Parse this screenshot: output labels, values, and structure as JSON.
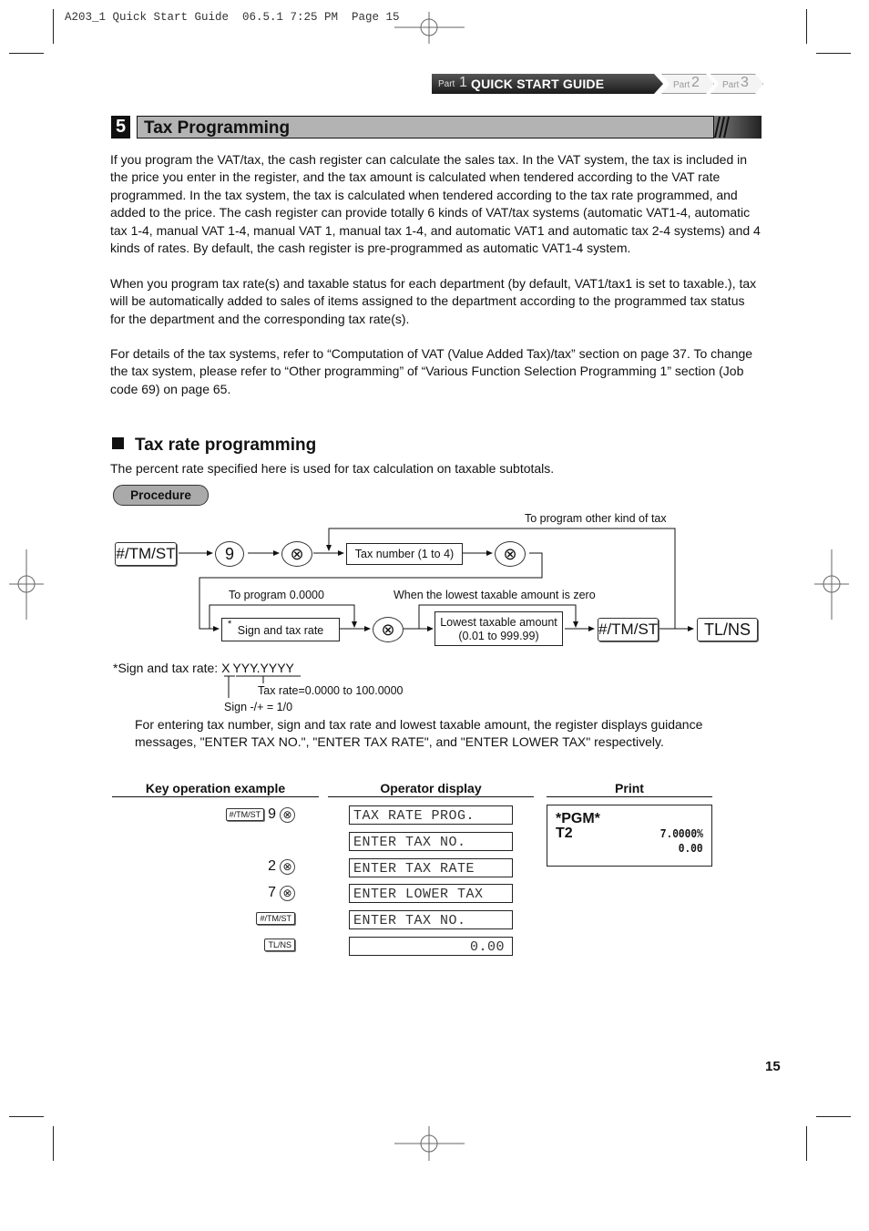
{
  "slug": "A203_1 Quick Start Guide  06.5.1 7:25 PM  Page 15",
  "part_nav": {
    "active": {
      "prefix": "Part",
      "number": "1",
      "title": "QUICK START GUIDE"
    },
    "others": [
      {
        "prefix": "Part",
        "number": "2"
      },
      {
        "prefix": "Part",
        "number": "3"
      }
    ]
  },
  "section": {
    "number": "5",
    "title": "Tax Programming"
  },
  "paragraphs": [
    "If you program the VAT/tax, the cash register can calculate the sales tax.  In the VAT system, the tax is included in the price you enter in the register, and the tax amount is calculated when tendered according to the VAT rate programmed.  In the tax system, the tax is calculated when tendered according to the tax rate programmed, and added to the price. The cash register can provide totally 6 kinds of VAT/tax systems (automatic VAT1-4, automatic tax 1-4, manual VAT 1-4, manual VAT 1, manual tax 1-4, and automatic VAT1 and automatic tax 2-4 systems) and 4 kinds of rates.  By default, the cash register is pre-programmed as automatic VAT1-4 system.",
    "When you program tax rate(s) and taxable status for each department (by default, VAT1/tax1 is set to taxable.), tax will be automatically added to sales of items assigned to the department according to the programmed tax status for the department and the corresponding tax rate(s).",
    "For details of the tax systems, refer to “Computation of VAT (Value Added Tax)/tax” section on page 37.  To change the tax system, please refer to “Other programming” of “Various Function Selection Programming 1” section (Job code 69) on page 65."
  ],
  "subsection": {
    "title": "Tax rate programming",
    "description": "The percent rate specified here is used for tax calculation on taxable subtotals.",
    "procedure_label": "Procedure"
  },
  "flow": {
    "key_tmst": "#/TM/ST",
    "key_9": "9",
    "key_x": "⊗",
    "tax_number_box": "Tax number (1 to 4)",
    "loop_label": "To program other kind of tax",
    "zero_rate_label": "To program  0.0000",
    "sign_rate_asterisk": "*",
    "sign_rate_box": "Sign and tax rate",
    "zero_amount_label": "When the lowest taxable amount is zero",
    "lowest_amount_box_line1": "Lowest taxable amount",
    "lowest_amount_box_line2": "(0.01 to 999.99)",
    "key_tlns": "TL/NS"
  },
  "format_note": {
    "prefix": "*Sign and tax rate: ",
    "sign_char": "X",
    "rate_chars": "YYY.YYYY",
    "rate_desc": "Tax rate=0.0000 to 100.0000",
    "sign_desc": "Sign -/+ = 1/0"
  },
  "guidance_note": "For entering tax number, sign and tax rate and lowest taxable amount, the register displays guidance messages, \"ENTER TAX NO.\", \"ENTER TAX RATE\", and \"ENTER LOWER TAX\" respectively.",
  "example": {
    "headers": {
      "keys": "Key operation example",
      "display": "Operator display",
      "print": "Print"
    },
    "key_rows": [
      {
        "key": "#/TM/ST",
        "digit": "9",
        "circle": "⊗"
      },
      {
        "digit": "2",
        "circle": "⊗"
      },
      {
        "digit": "7",
        "circle": "⊗"
      },
      {
        "key": "#/TM/ST"
      },
      {
        "key": "TL/NS"
      }
    ],
    "display_rows": [
      "TAX RATE PROG.",
      "ENTER TAX NO.",
      "ENTER TAX RATE",
      "ENTER LOWER TAX",
      "ENTER TAX NO.",
      "0.00"
    ],
    "print": {
      "header": "*PGM*",
      "tax_label": "T2",
      "rate": "7.0000%",
      "amount": "0.00"
    }
  },
  "page_number": "15"
}
